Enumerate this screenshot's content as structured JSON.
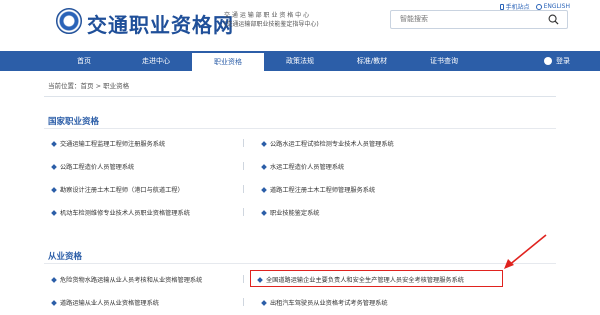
{
  "header": {
    "brand": "交通职业资格网",
    "org_line1": "交 通 运 输 部 职 业 资 格 中 心",
    "org_line2": "(交通运输部职业技能鉴定指导中心)",
    "top_links": [
      "手机站点",
      "ENGLISH"
    ],
    "search_placeholder": "智能搜索"
  },
  "nav": {
    "items": [
      "首页",
      "走进中心",
      "职业资格",
      "政策法规",
      "标准/教材",
      "证书查询"
    ],
    "active": "职业资格",
    "login": "登录"
  },
  "breadcrumb": "当前位置：首页 > 职业资格",
  "sections": [
    {
      "title": "国家职业资格",
      "items": [
        "交通运输工程监理工程师注册服务系统",
        "公路水运工程试验检测专业技术人员管理系统",
        "公路工程造价人员管理系统",
        "水运工程造价人员管理系统",
        "勘察设计注册土木工程师（港口与航道工程）",
        "道路工程注册土木工程师管理服务系统",
        "机动车检测维修专业技术人员职业资格管理系统",
        "职业技能鉴定系统"
      ]
    },
    {
      "title": "从业资格",
      "items": [
        "危险货物水路运输从业人员考核和从业资格管理系统",
        "全国道路运输企业主要负责人和安全生产管理人员安全考核管理服务系统",
        "道路运输从业人员从业资格管理系统",
        "出租汽车驾驶员从业资格考试考务管理系统"
      ]
    }
  ],
  "colors": {
    "primary": "#2c5ea8",
    "highlight": "#e0231f"
  }
}
